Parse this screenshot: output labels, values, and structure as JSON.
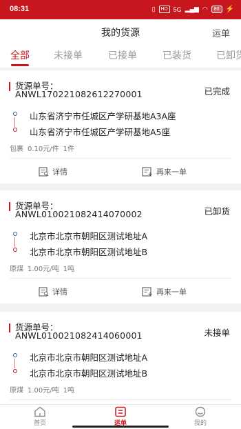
{
  "status_bar": {
    "time": "08:31",
    "hd_label": "HD",
    "signal_label": "5G",
    "battery": "80"
  },
  "header": {
    "title": "我的货源",
    "right_label": "运单"
  },
  "tabs": [
    {
      "label": "全部",
      "active": true
    },
    {
      "label": "未接单"
    },
    {
      "label": "已接单"
    },
    {
      "label": "已装货"
    },
    {
      "label": "已卸货"
    }
  ],
  "orders": [
    {
      "no_label": "货源单号：",
      "no": "ANWL170221082612270001",
      "status": "已完成",
      "from": "山东省济宁市任城区产学研基地A3A座",
      "to": "山东省济宁市任城区产学研基地A5座",
      "goods": "包裹",
      "price": "0.10元/件",
      "qty": "1件",
      "detail_label": "详情",
      "reorder_label": "再来一单"
    },
    {
      "no_label": "货源单号：",
      "no": "ANWL010021082414070002",
      "status": "已卸货",
      "from": "北京市北京市朝阳区测试地址A",
      "to": "北京市北京市朝阳区测试地址B",
      "goods": "原煤",
      "price": "1.00元/吨",
      "qty": "1吨",
      "detail_label": "详情",
      "reorder_label": "再来一单"
    },
    {
      "no_label": "货源单号：",
      "no": "ANWL010021082414060001",
      "status": "未接单",
      "from": "北京市北京市朝阳区测试地址A",
      "to": "北京市北京市朝阳区测试地址B",
      "goods": "原煤",
      "price": "1.00元/吨",
      "qty": "1吨"
    }
  ],
  "tabbar": [
    {
      "label": "首页",
      "icon": "home-icon"
    },
    {
      "label": "运单",
      "icon": "waybill-icon",
      "active": true
    },
    {
      "label": "我的",
      "icon": "profile-icon"
    }
  ],
  "colors": {
    "brand": "#c8161e",
    "from_dot": "#3b5998"
  }
}
